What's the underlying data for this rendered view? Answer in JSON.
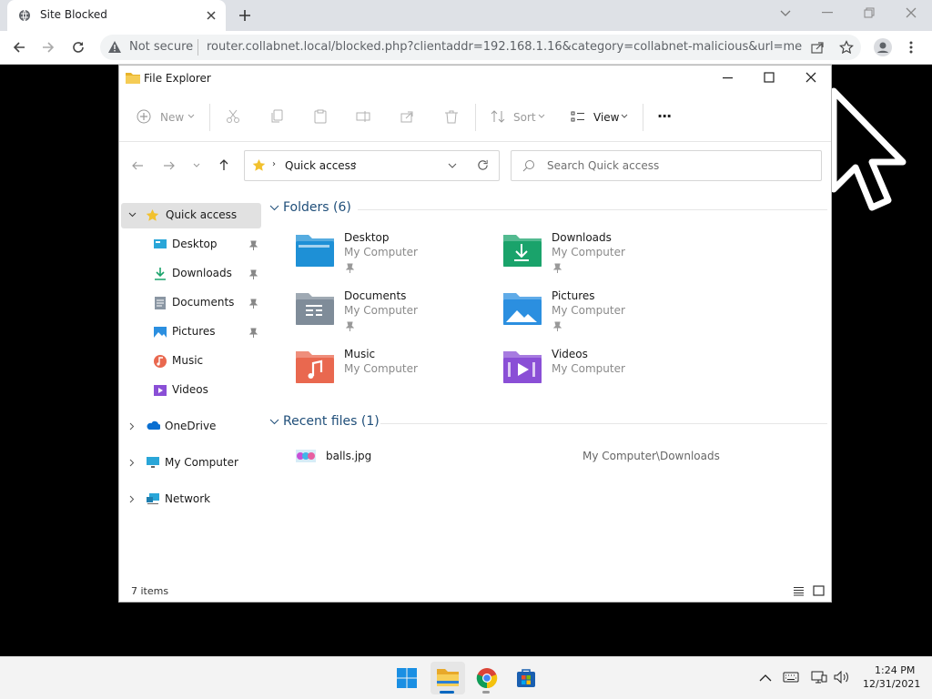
{
  "browser": {
    "tab_title": "Site Blocked",
    "not_secure": "Not secure",
    "url": "router.collabnet.local/blocked.php?clientaddr=192.168.1.16&category=collabnet-malicious&url=memz-..."
  },
  "explorer": {
    "title": "File Explorer",
    "commands": {
      "new": "New",
      "sort": "Sort",
      "view": "View",
      "more": "···"
    },
    "address": "Quick access",
    "search_placeholder": "Search Quick access",
    "sidebar": {
      "quick_access": "Quick access",
      "items": [
        {
          "label": "Desktop",
          "icon": "desktop-icon",
          "pinned": true
        },
        {
          "label": "Downloads",
          "icon": "downloads-icon",
          "pinned": true
        },
        {
          "label": "Documents",
          "icon": "documents-icon",
          "pinned": true
        },
        {
          "label": "Pictures",
          "icon": "pictures-icon",
          "pinned": true
        },
        {
          "label": "Music",
          "icon": "music-icon",
          "pinned": false
        },
        {
          "label": "Videos",
          "icon": "videos-icon",
          "pinned": false
        }
      ],
      "onedrive": "OneDrive",
      "my_computer": "My Computer",
      "network": "Network"
    },
    "folders_header": "Folders (6)",
    "folders": [
      {
        "name": "Desktop",
        "location": "My Computer",
        "pinned": true,
        "color": "#1e90d6"
      },
      {
        "name": "Downloads",
        "location": "My Computer",
        "pinned": true,
        "color": "#1aa36b"
      },
      {
        "name": "Documents",
        "location": "My Computer",
        "pinned": true,
        "color": "#7f8c99"
      },
      {
        "name": "Pictures",
        "location": "My Computer",
        "pinned": true,
        "color": "#2b8fe0"
      },
      {
        "name": "Music",
        "location": "My Computer",
        "pinned": false,
        "color": "#e9684f"
      },
      {
        "name": "Videos",
        "location": "My Computer",
        "pinned": false,
        "color": "#8a4fd6"
      }
    ],
    "recent_header": "Recent files (1)",
    "recent": [
      {
        "name": "balls.jpg",
        "path": "My Computer\\Downloads"
      }
    ],
    "status": "7 items"
  },
  "taskbar": {
    "time": "1:24 PM",
    "date": "12/31/2021"
  }
}
